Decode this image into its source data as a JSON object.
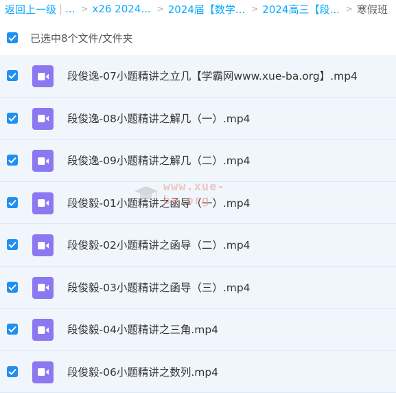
{
  "breadcrumb": {
    "back_label": "返回上一级",
    "pipe": "|",
    "ellipsis": "...",
    "separator": ">",
    "crumbs": [
      "x26 2024...",
      "2024届【数学...",
      "2024高三【段..."
    ],
    "current": "寒假班"
  },
  "selection": {
    "checked": true,
    "label": "已选中8个文件/文件夹"
  },
  "files": [
    {
      "name": "段俊逸-07小题精讲之立几【学霸网www.xue-ba.org】.mp4",
      "checked": true,
      "icon": "video-file-icon"
    },
    {
      "name": "段俊逸-08小题精讲之解几（一）.mp4",
      "checked": true,
      "icon": "video-file-icon"
    },
    {
      "name": "段俊逸-09小题精讲之解几（二）.mp4",
      "checked": true,
      "icon": "video-file-icon"
    },
    {
      "name": "段俊毅-01小题精讲之函导（一）.mp4",
      "checked": true,
      "icon": "video-file-icon"
    },
    {
      "name": "段俊毅-02小题精讲之函导（二）.mp4",
      "checked": true,
      "icon": "video-file-icon"
    },
    {
      "name": "段俊毅-03小题精讲之函导（三）.mp4",
      "checked": true,
      "icon": "video-file-icon"
    },
    {
      "name": "段俊毅-04小题精讲之三角.mp4",
      "checked": true,
      "icon": "video-file-icon"
    },
    {
      "name": "段俊毅-06小题精讲之数列.mp4",
      "checked": true,
      "icon": "video-file-icon"
    }
  ],
  "watermark": {
    "text": "www.xue-ba.org",
    "icon": "graduation-cap-icon"
  },
  "colors": {
    "link": "#09aaff",
    "checkbox": "#1f8ff0",
    "row_bg": "#f1f6fd",
    "video_icon": "#8c78f0"
  }
}
